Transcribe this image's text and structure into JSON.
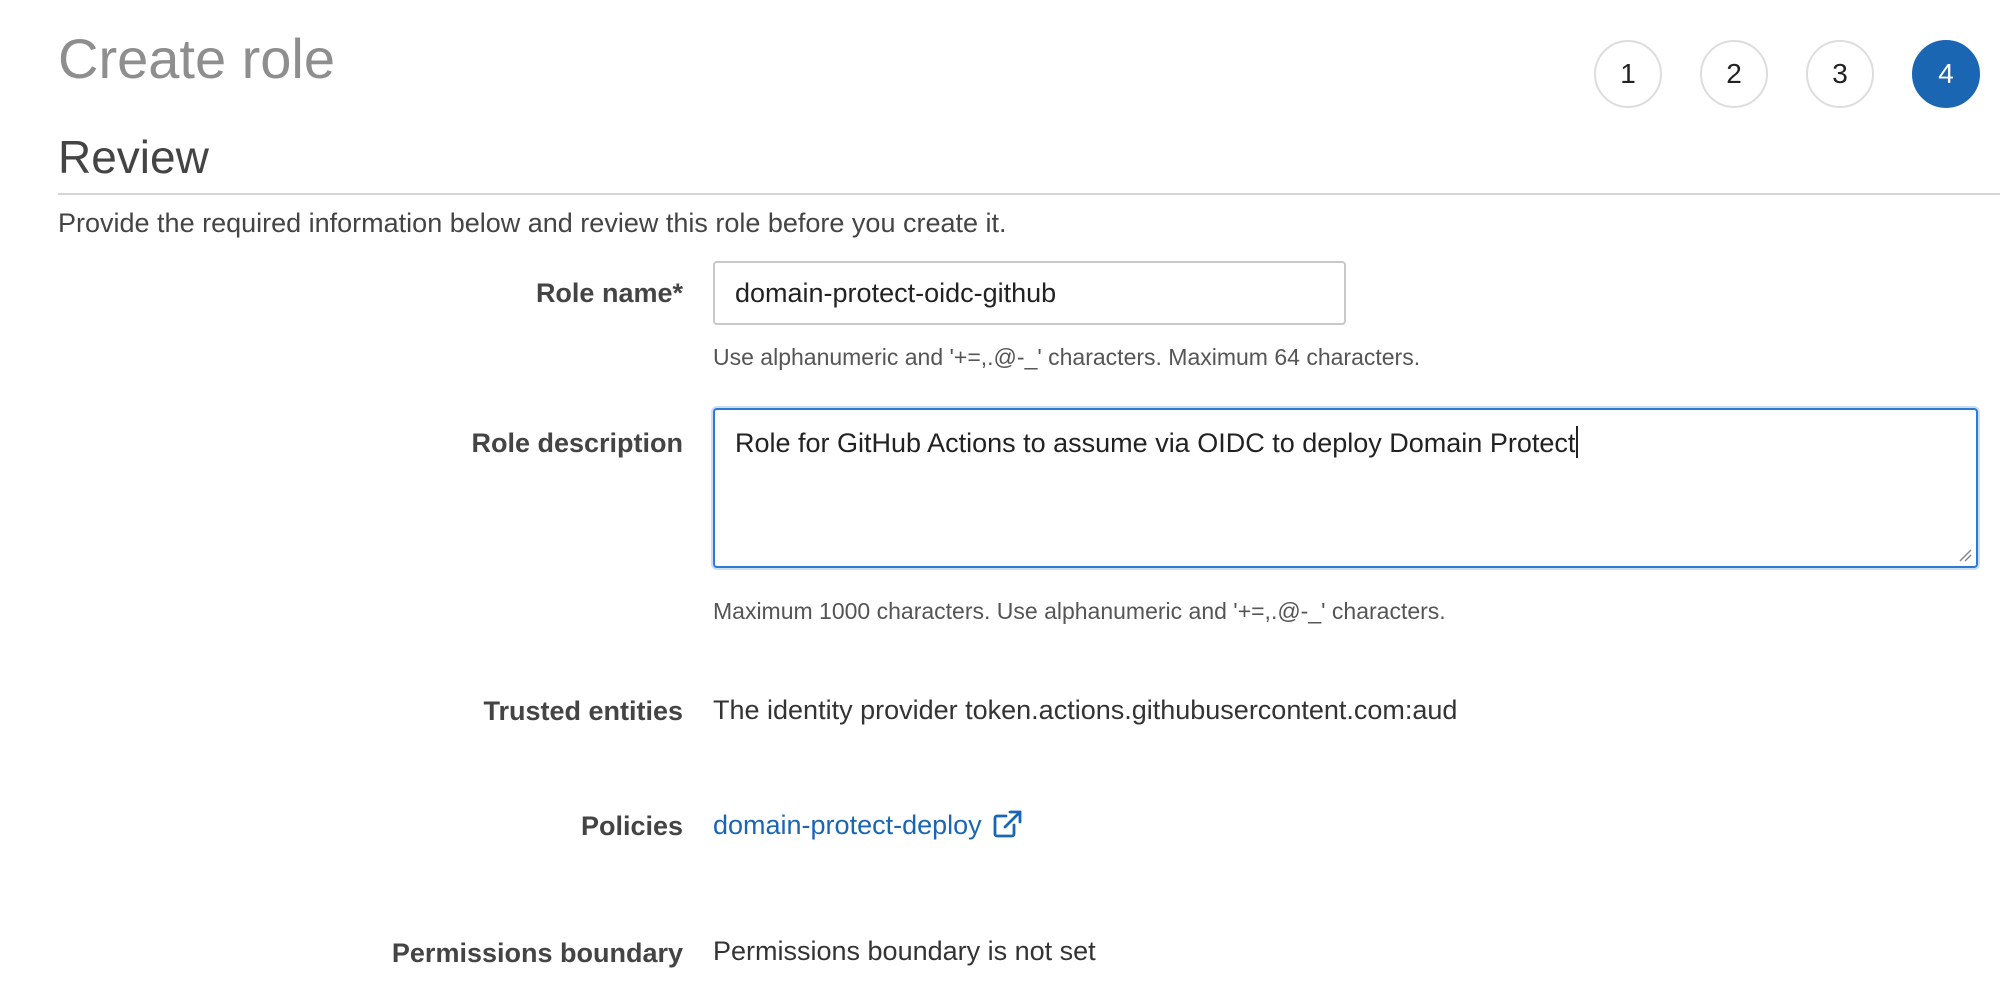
{
  "header": {
    "title": "Create role",
    "steps": [
      {
        "label": "1",
        "active": false
      },
      {
        "label": "2",
        "active": false
      },
      {
        "label": "3",
        "active": false
      },
      {
        "label": "4",
        "active": true
      }
    ]
  },
  "section": {
    "title": "Review",
    "intro": "Provide the required information below and review this role before you create it."
  },
  "form": {
    "role_name": {
      "label": "Role name*",
      "value": "domain-protect-oidc-github",
      "hint": "Use alphanumeric and '+=,.@-_' characters. Maximum 64 characters."
    },
    "role_description": {
      "label": "Role description",
      "value": "Role for GitHub Actions to assume via OIDC to deploy Domain Protect",
      "hint": "Maximum 1000 characters. Use alphanumeric and '+=,.@-_' characters."
    },
    "trusted_entities": {
      "label": "Trusted entities",
      "value": "The identity provider token.actions.githubusercontent.com:aud"
    },
    "policies": {
      "label": "Policies",
      "link_text": "domain-protect-deploy",
      "icon": "external-link-icon"
    },
    "permissions_boundary": {
      "label": "Permissions boundary",
      "value": "Permissions boundary is not set"
    }
  },
  "colors": {
    "accent": "#1a66b3",
    "focus_border": "#2e7ad1",
    "title_gray": "#8e8e8e"
  }
}
